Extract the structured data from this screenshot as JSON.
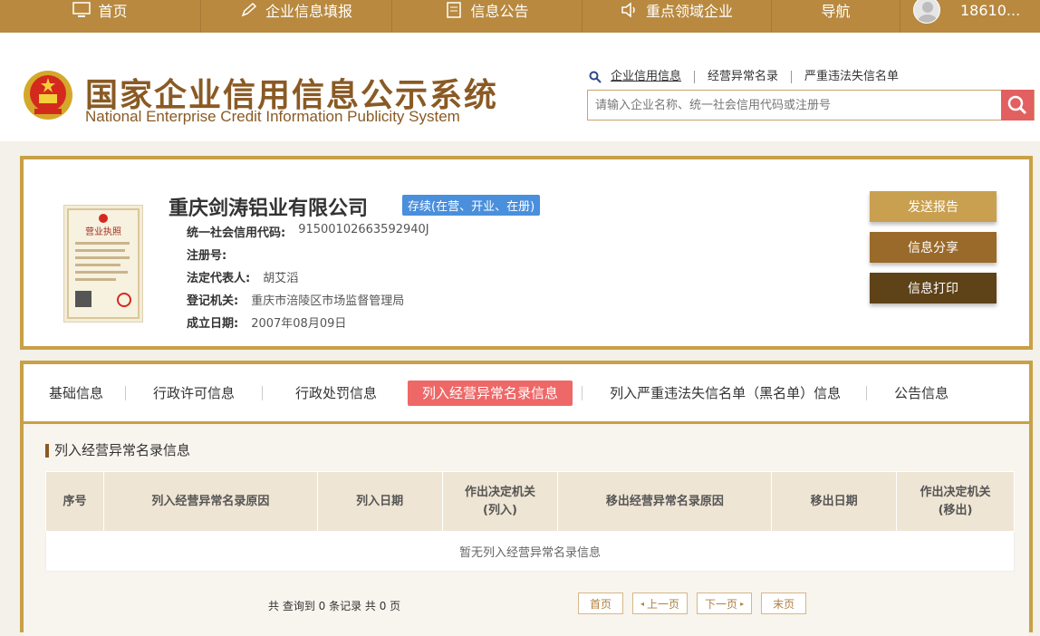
{
  "topnav": {
    "items": [
      {
        "label": "首页",
        "icon": "monitor-icon"
      },
      {
        "label": "企业信息填报",
        "icon": "pen-icon"
      },
      {
        "label": "信息公告",
        "icon": "document-icon"
      },
      {
        "label": "重点领域企业",
        "icon": "speaker-icon"
      },
      {
        "label": "导航",
        "icon": ""
      }
    ],
    "user": "18610..."
  },
  "header": {
    "title_cn": "国家企业信用信息公示系统",
    "title_en": "National Enterprise Credit Information Publicity System",
    "search_tabs": [
      "企业信用信息",
      "经营异常名录",
      "严重违法失信名单"
    ],
    "search_placeholder": "请输入企业名称、统一社会信用代码或注册号"
  },
  "company": {
    "name": "重庆剑涛铝业有限公司",
    "status": "存续(在营、开业、在册)",
    "fields": [
      {
        "label": "统一社会信用代码:",
        "value": "91500102663592940J"
      },
      {
        "label": "注册号:",
        "value": ""
      },
      {
        "label": "法定代表人:",
        "value": "胡艾滔"
      },
      {
        "label": "登记机关:",
        "value": "重庆市涪陵区市场监督管理局"
      },
      {
        "label": "成立日期:",
        "value": "2007年08月09日"
      }
    ],
    "license_title": "营业执照",
    "actions": [
      {
        "label": "发送报告",
        "color": "#c8a050"
      },
      {
        "label": "信息分享",
        "color": "#9a6a2a"
      },
      {
        "label": "信息打印",
        "color": "#5e4218"
      }
    ]
  },
  "tabs": [
    {
      "label": "基础信息",
      "active": false
    },
    {
      "label": "行政许可信息",
      "active": false
    },
    {
      "label": "行政处罚信息",
      "active": false
    },
    {
      "label": "列入经营异常名录信息",
      "active": true
    },
    {
      "label": "列入严重违法失信名单（黑名单）信息",
      "active": false
    },
    {
      "label": "公告信息",
      "active": false
    }
  ],
  "section": {
    "title": "列入经营异常名录信息",
    "columns": [
      "序号",
      "列入经营异常名录原因",
      "列入日期",
      "作出决定机关\n(列入)",
      "移出经营异常名录原因",
      "移出日期",
      "作出决定机关\n(移出)"
    ],
    "empty_text": "暂无列入经营异常名录信息",
    "pager_info": "共 查询到 0 条记录 共 0 页",
    "pager": {
      "first": "首页",
      "prev": "上一页",
      "next": "下一页",
      "last": "末页"
    }
  },
  "colors": {
    "gold": "#b8893f",
    "border": "#c8a046",
    "brown_text": "#8a5a24",
    "active_tab": "#ee6868",
    "status_blue": "#4a8fdc",
    "search_btn": "#e26060"
  }
}
